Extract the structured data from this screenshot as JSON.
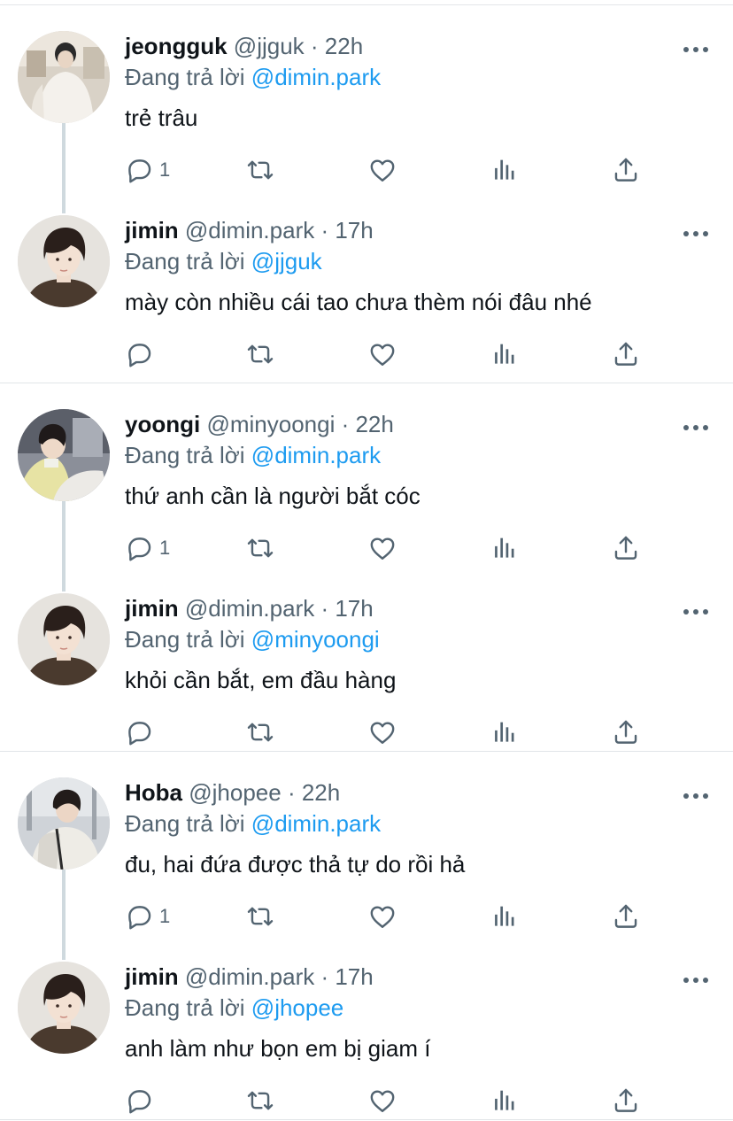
{
  "threads": [
    {
      "tweets": [
        {
          "name": "jeongguk",
          "handle": "@jjguk",
          "time": "22h",
          "reply_prefix": "Đang trả lời",
          "reply_to": "@dimin.park",
          "text": "trẻ trâu",
          "reply_count": "1",
          "avatar": "jeongguk"
        },
        {
          "name": "jimin",
          "handle": "@dimin.park",
          "time": "17h",
          "reply_prefix": "Đang trả lời",
          "reply_to": "@jjguk",
          "text": "mày còn nhiều cái tao chưa thèm nói đâu nhé",
          "reply_count": "",
          "avatar": "jimin"
        }
      ]
    },
    {
      "tweets": [
        {
          "name": "yoongi",
          "handle": "@minyoongi",
          "time": "22h",
          "reply_prefix": "Đang trả lời",
          "reply_to": "@dimin.park",
          "text": "thứ anh cần là người bắt cóc",
          "reply_count": "1",
          "avatar": "yoongi"
        },
        {
          "name": "jimin",
          "handle": "@dimin.park",
          "time": "17h",
          "reply_prefix": "Đang trả lời",
          "reply_to": "@minyoongi",
          "text": "khỏi cần bắt, em đầu hàng",
          "reply_count": "",
          "avatar": "jimin"
        }
      ]
    },
    {
      "tweets": [
        {
          "name": "Hoba",
          "handle": "@jhopee",
          "time": "22h",
          "reply_prefix": "Đang trả lời",
          "reply_to": "@dimin.park",
          "text": "đu, hai đứa được thả tự do rồi hả",
          "reply_count": "1",
          "avatar": "hoba"
        },
        {
          "name": "jimin",
          "handle": "@dimin.park",
          "time": "17h",
          "reply_prefix": "Đang trả lời",
          "reply_to": "@jhopee",
          "text": "anh làm như bọn em bị giam í",
          "reply_count": "",
          "avatar": "jimin"
        }
      ]
    }
  ],
  "colors": {
    "text": "#0f1419",
    "secondary": "#536471",
    "link": "#1d9bf0",
    "divider": "#e1e5e8",
    "thread_line": "#cfd9de"
  },
  "icons": [
    "reply-icon",
    "retweet-icon",
    "like-icon",
    "analytics-icon",
    "share-icon",
    "more-icon"
  ]
}
